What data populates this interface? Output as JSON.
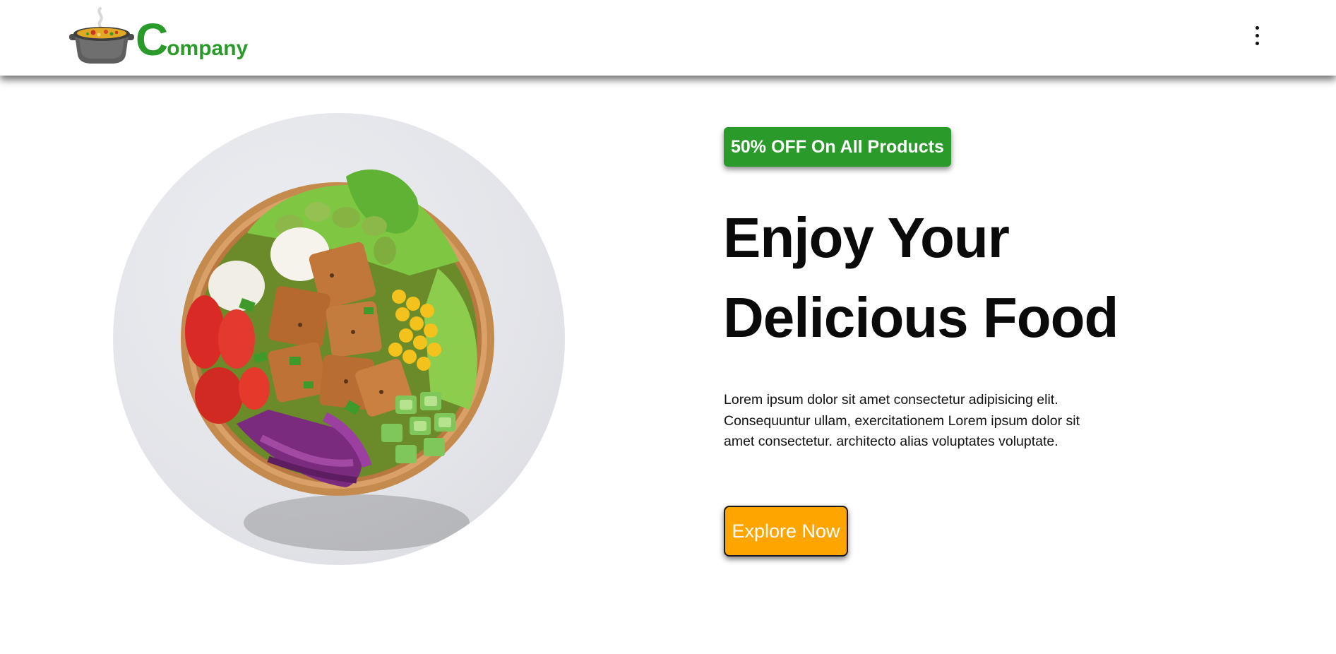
{
  "header": {
    "logo": {
      "icon": "cooking-pot-icon",
      "text_initial": "C",
      "text_rest": "ompany",
      "color": "#2a9a2a"
    },
    "menu_icon": "more-vertical-icon"
  },
  "hero": {
    "image": "salad-bowl-image",
    "badge": "50% OFF On All Products",
    "badge_color": "#2a9a2a",
    "title_line1": "Enjoy Your",
    "title_line2": "Delicious Food",
    "description": "Lorem ipsum dolor sit amet consectetur adipisicing elit. Consequuntur ullam, exercitationem Lorem ipsum dolor sit amet consectetur. architecto alias voluptates voluptate.",
    "cta_label": "Explore Now",
    "cta_color": "#ffa500"
  }
}
